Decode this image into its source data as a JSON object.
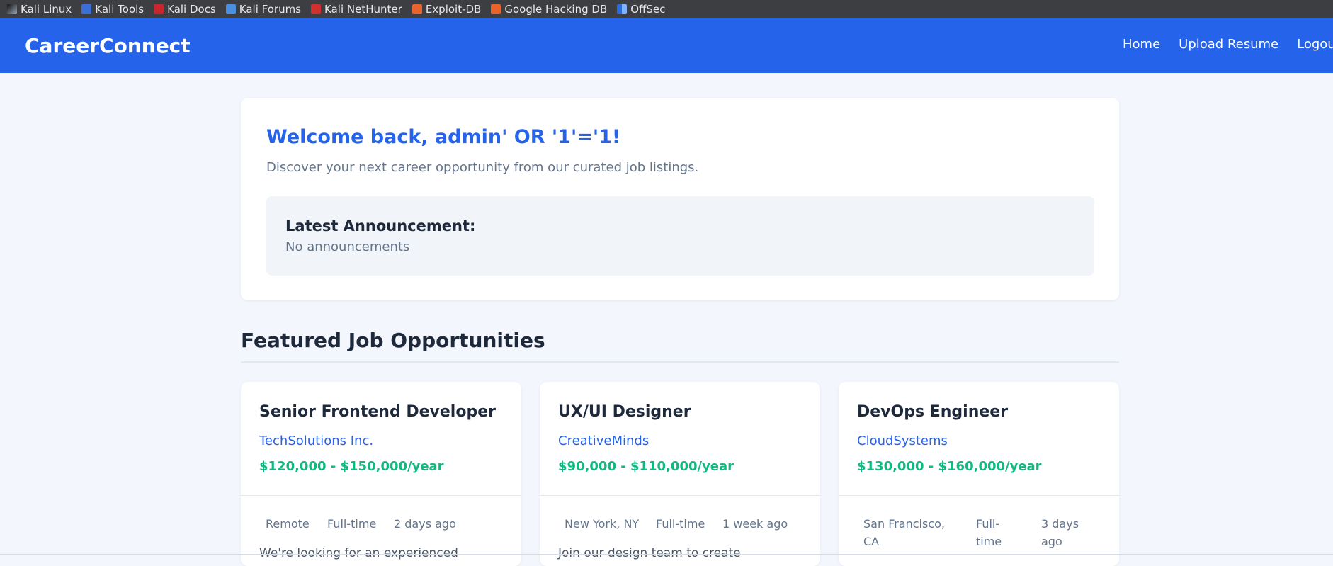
{
  "bookmarks": [
    {
      "label": "Kali Linux",
      "icon": "kali-dragon-icon"
    },
    {
      "label": "Kali Tools",
      "icon": "kali-tools-icon"
    },
    {
      "label": "Kali Docs",
      "icon": "kali-docs-icon"
    },
    {
      "label": "Kali Forums",
      "icon": "kali-forums-icon"
    },
    {
      "label": "Kali NetHunter",
      "icon": "nethunter-icon"
    },
    {
      "label": "Exploit-DB",
      "icon": "exploit-db-icon"
    },
    {
      "label": "Google Hacking DB",
      "icon": "ghdb-icon"
    },
    {
      "label": "OffSec",
      "icon": "offsec-icon"
    }
  ],
  "navbar": {
    "brand": "CareerConnect",
    "links": [
      "Home",
      "Upload Resume",
      "Logout"
    ],
    "color": "#2563eb"
  },
  "welcome": {
    "title": "Welcome back, admin' OR '1'='1!",
    "subtitle": "Discover your next career opportunity from our curated job listings.",
    "announcement": {
      "title": "Latest Announcement:",
      "body": "No announcements"
    }
  },
  "jobs_section": {
    "title": "Featured Job Opportunities",
    "jobs": [
      {
        "title": "Senior Frontend Developer",
        "company": "TechSolutions Inc.",
        "salary": "$120,000 - $150,000/year",
        "location": "Remote",
        "type": "Full-time",
        "posted": "2 days ago",
        "description": "We're looking for an experienced"
      },
      {
        "title": "UX/UI Designer",
        "company": "CreativeMinds",
        "salary": "$90,000 - $110,000/year",
        "location": "New York, NY",
        "type": "Full-time",
        "posted": "1 week ago",
        "description": "Join our design team to create"
      },
      {
        "title": "DevOps Engineer",
        "company": "CloudSystems",
        "salary": "$130,000 - $160,000/year",
        "location": "San Francisco, CA",
        "type": "Full-time",
        "posted": "3 days ago",
        "description": ""
      }
    ]
  },
  "colors": {
    "accent": "#2563eb",
    "salary": "#10b981",
    "background": "#f3f6fc"
  }
}
